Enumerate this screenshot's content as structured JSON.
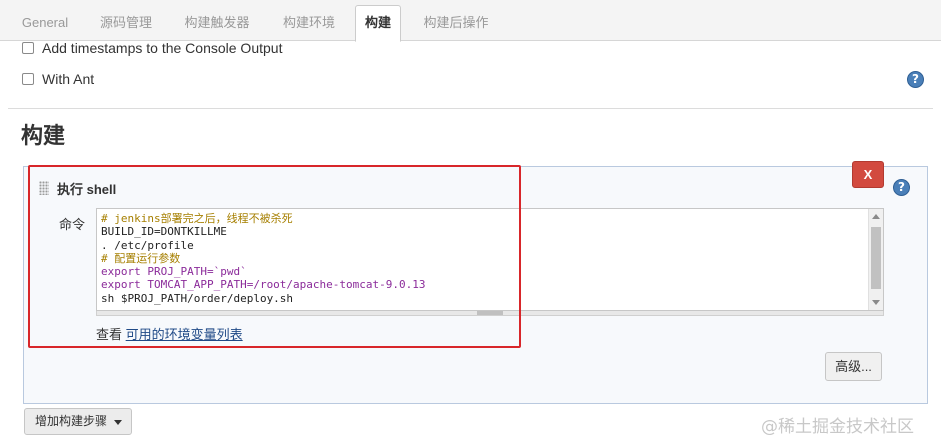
{
  "tabs": [
    {
      "label": "General"
    },
    {
      "label": "源码管理"
    },
    {
      "label": "构建触发器"
    },
    {
      "label": "构建环境"
    },
    {
      "label": "构建"
    },
    {
      "label": "构建后操作"
    }
  ],
  "options": {
    "timestamps_label": "Add timestamps to the Console Output",
    "ant_label": "With Ant",
    "help_glyph": "?"
  },
  "section": {
    "title": "构建"
  },
  "step": {
    "title": "执行 shell",
    "remove_label": "X",
    "command_label": "命令",
    "code_lines": [
      "# jenkins部署完之后，线程不被杀死",
      "BUILD_ID=DONTKILLME",
      ". /etc/profile",
      "# 配置运行参数",
      "export PROJ_PATH=`pwd`",
      "export TOMCAT_APP_PATH=/root/apache-tomcat-9.0.13",
      "sh $PROJ_PATH/order/deploy.sh"
    ],
    "env_prefix": "查看",
    "env_link": "可用的环境变量列表",
    "advanced_label": "高级..."
  },
  "add_step_label": "增加构建步骤",
  "watermark": "@稀土掘金技术社区",
  "colors": {
    "remove_button": "#d24a3f",
    "highlight_box": "#d8262a",
    "link": "#204a87"
  }
}
